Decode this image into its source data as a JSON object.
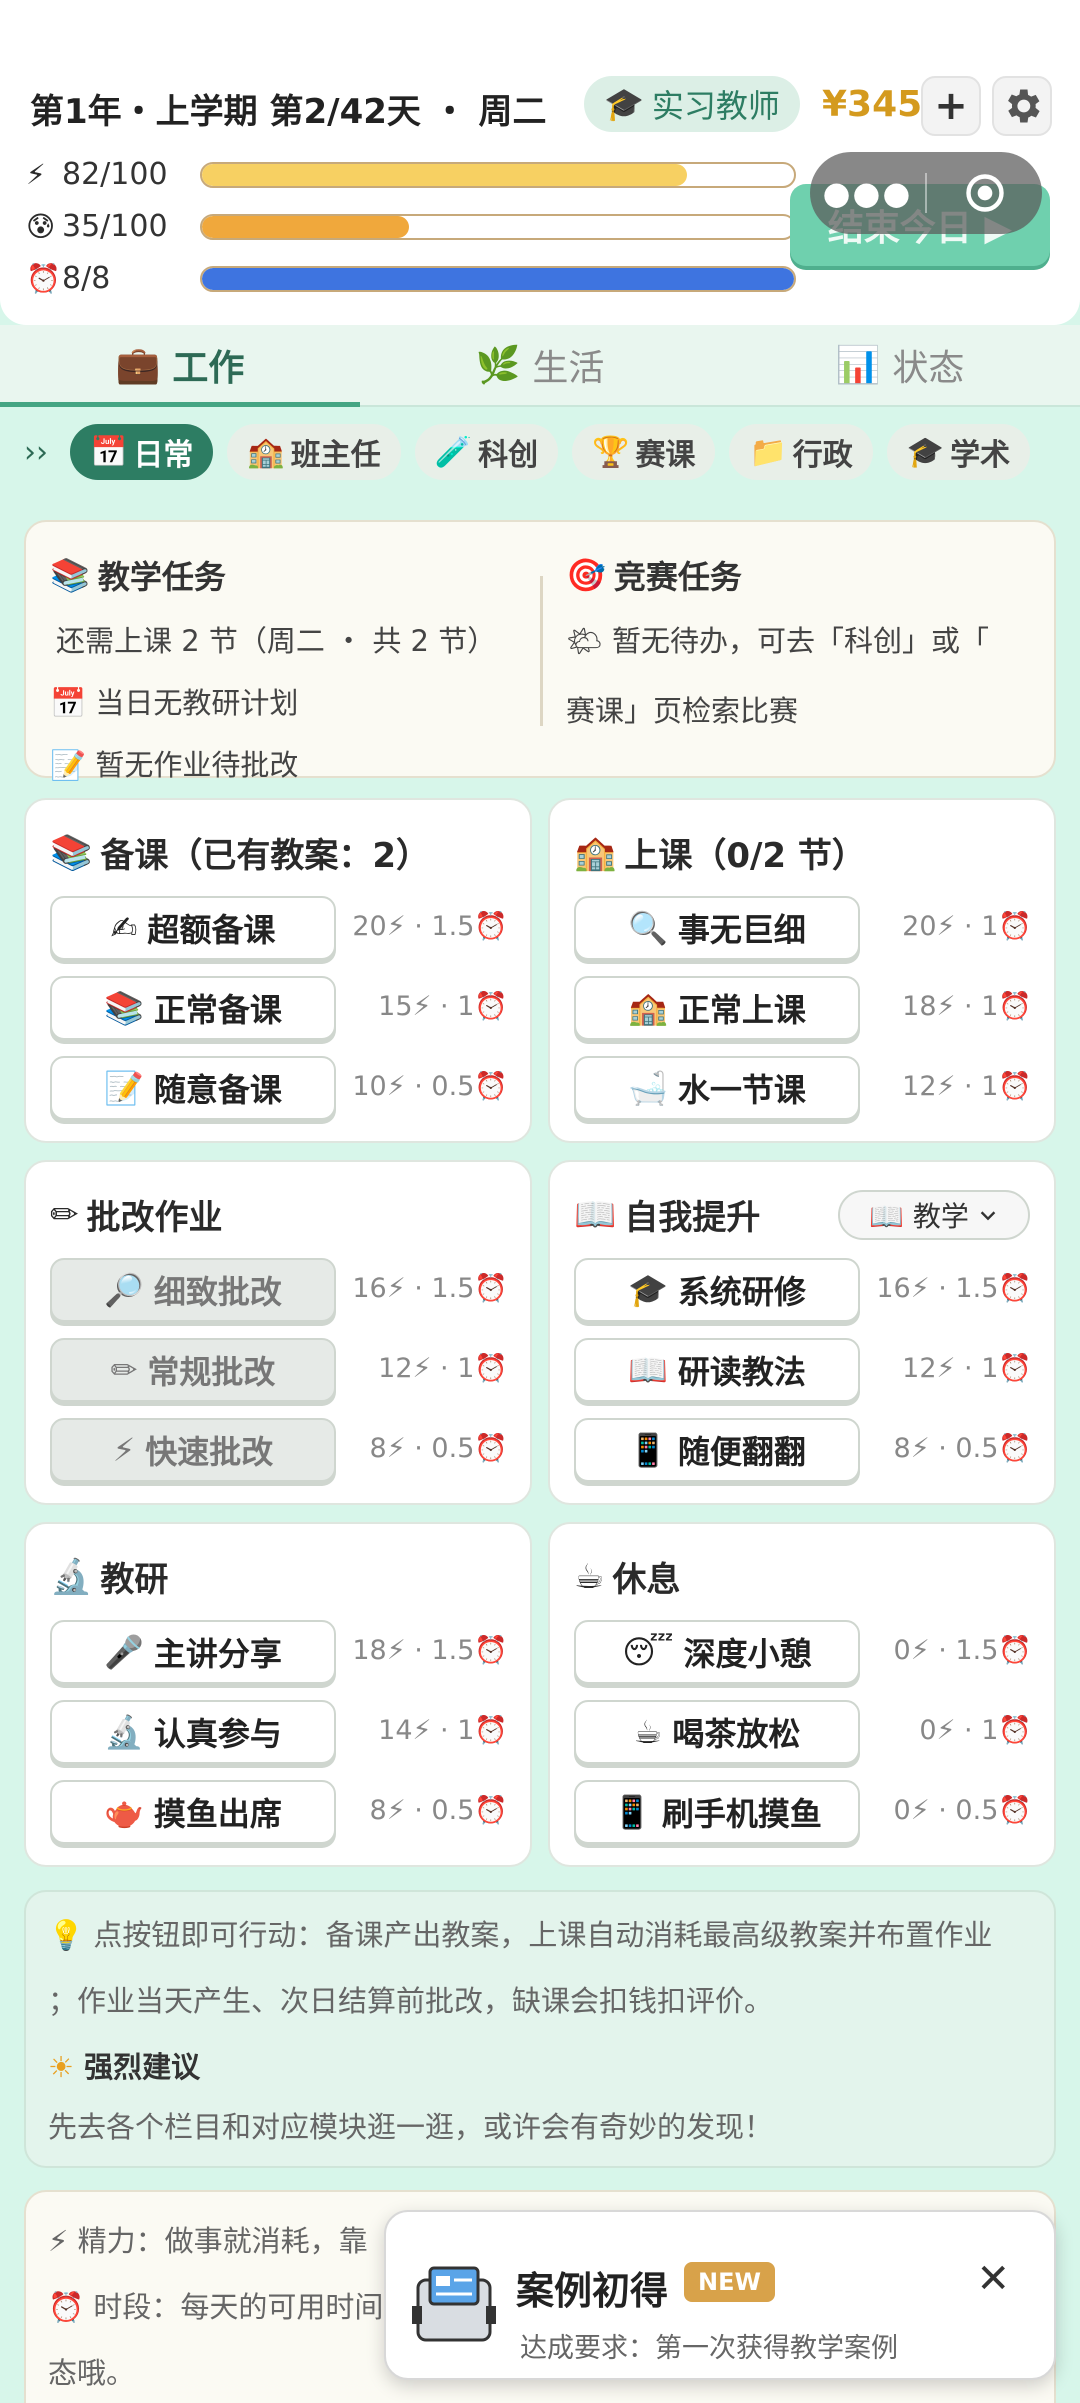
{
  "header": {
    "date": "第1年・上学期 第2/42天 ・ 周二",
    "role": "实习教师",
    "money": "¥345",
    "plus": "+",
    "end_day": "结束今日 ▶"
  },
  "stats": [
    {
      "icon": "⚡",
      "value": "82/100",
      "fill": 0.82,
      "color": "#f7d062"
    },
    {
      "icon": "😰",
      "value": "35/100",
      "fill": 0.35,
      "color": "#f0a83c"
    },
    {
      "icon": "⏰",
      "value": "8/8",
      "fill": 1.0,
      "color": "#3e74e0"
    }
  ],
  "tabs": [
    {
      "icon": "💼",
      "label": "工作"
    },
    {
      "icon": "🌿",
      "label": "生活"
    },
    {
      "icon": "📊",
      "label": "状态"
    }
  ],
  "chips": {
    "arrow": "››",
    "items": [
      {
        "icon": "📅",
        "label": "日常"
      },
      {
        "icon": "🏫",
        "label": "班主任"
      },
      {
        "icon": "🧪",
        "label": "科创"
      },
      {
        "icon": "🏆",
        "label": "赛课"
      },
      {
        "icon": "📁",
        "label": "行政"
      },
      {
        "icon": "🎓",
        "label": "学术"
      }
    ]
  },
  "tasks": {
    "teaching": {
      "title": "教学任务",
      "icon": "📚",
      "lines": [
        {
          "icon": "",
          "text": "还需上课 2 节（周二 ・ 共 2 节）"
        },
        {
          "icon": "📅",
          "text": "当日无教研计划"
        },
        {
          "icon": "📝",
          "text": "暂无作业待批改"
        }
      ]
    },
    "contest": {
      "title": "竞赛任务",
      "icon": "🎯",
      "line1": "暂无待办，可去「科创」或「",
      "line1_icon": "🌤",
      "line2": "赛课」页检索比赛"
    }
  },
  "cards": {
    "prep": {
      "icon": "📚",
      "title": "备课（已有教案：2）",
      "buttons": [
        {
          "icon": "✍",
          "label": "超额备课",
          "cost": "20⚡ · 1.5⏰"
        },
        {
          "icon": "📚",
          "label": "正常备课",
          "cost": "15⚡ · 1⏰"
        },
        {
          "icon": "📝",
          "label": "随意备课",
          "cost": "10⚡ · 0.5⏰"
        }
      ]
    },
    "class": {
      "icon": "🏫",
      "title": "上课（0/2 节）",
      "buttons": [
        {
          "icon": "🔍",
          "label": "事无巨细",
          "cost": "20⚡ · 1⏰"
        },
        {
          "icon": "🏫",
          "label": "正常上课",
          "cost": "18⚡ · 1⏰"
        },
        {
          "icon": "🛁",
          "label": "水一节课",
          "cost": "12⚡ · 1⏰"
        }
      ]
    },
    "grade": {
      "icon": "✏",
      "title": "批改作业",
      "buttons": [
        {
          "icon": "🔎",
          "label": "细致批改",
          "cost": "16⚡ · 1.5⏰"
        },
        {
          "icon": "✏",
          "label": "常规批改",
          "cost": "12⚡ · 1⏰"
        },
        {
          "icon": "⚡",
          "label": "快速批改",
          "cost": "8⚡ · 0.5⏰"
        }
      ]
    },
    "self": {
      "icon": "📖",
      "title": "自我提升",
      "dropdown": "📖 教学",
      "buttons": [
        {
          "icon": "🎓",
          "label": "系统研修",
          "cost": "16⚡ · 1.5⏰"
        },
        {
          "icon": "📖",
          "label": "研读教法",
          "cost": "12⚡ · 1⏰"
        },
        {
          "icon": "📱",
          "label": "随便翻翻",
          "cost": "8⚡ · 0.5⏰"
        }
      ]
    },
    "research": {
      "icon": "🔬",
      "title": "教研",
      "buttons": [
        {
          "icon": "🎤",
          "label": "主讲分享",
          "cost": "18⚡ · 1.5⏰"
        },
        {
          "icon": "🔬",
          "label": "认真参与",
          "cost": "14⚡ · 1⏰"
        },
        {
          "icon": "🫖",
          "label": "摸鱼出席",
          "cost": "8⚡ · 0.5⏰"
        }
      ]
    },
    "rest": {
      "icon": "☕",
      "title": "休息",
      "buttons": [
        {
          "icon": "😴",
          "label": "深度小憩",
          "cost": "0⚡ · 1.5⏰"
        },
        {
          "icon": "☕",
          "label": "喝茶放松",
          "cost": "0⚡ · 1⏰"
        },
        {
          "icon": "📱",
          "label": "刷手机摸鱼",
          "cost": "0⚡ · 0.5⏰"
        }
      ]
    }
  },
  "tips": {
    "icon": "💡",
    "line1": "点按钮即可行动：备课产出教案，上课自动消耗最高级教案并布置作业",
    "line2": "；作业当天产生、次日结算前批改，缺课会扣钱扣评价。",
    "strong_icon": "☀",
    "strong_title": "强烈建议",
    "strong_text": "先去各个栏目和对应模块逛一逛，或许会有奇妙的发现！"
  },
  "info": {
    "line1": "⚡ 精力：做事就消耗，靠",
    "line2": "⏰ 时段：每天的可用时间",
    "line3": "态哦。"
  },
  "toast": {
    "title": "案例初得",
    "badge": "NEW",
    "subtitle": "达成要求：第一次获得教学案例",
    "close": "✕"
  }
}
